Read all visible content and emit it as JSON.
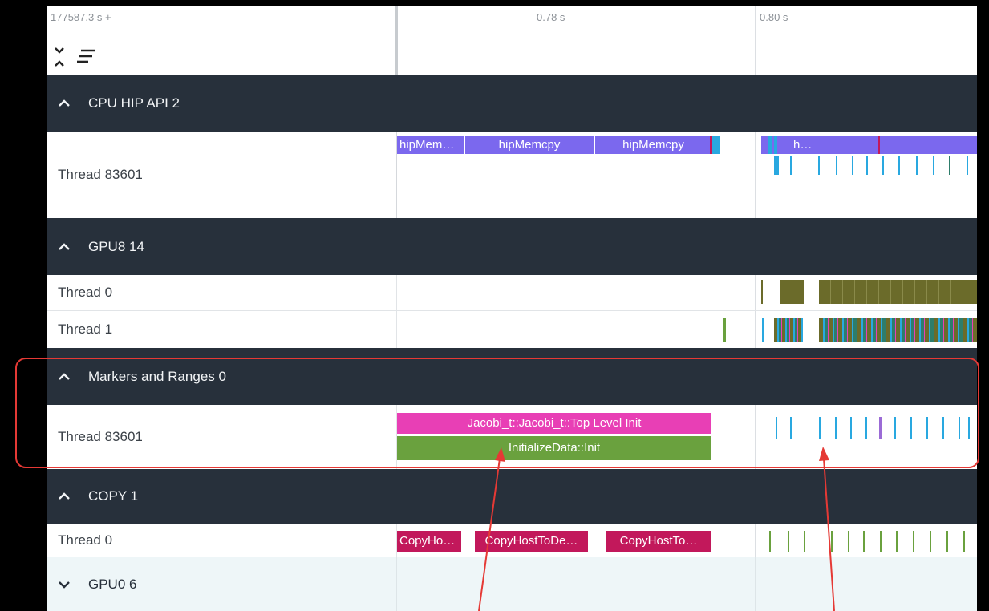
{
  "header": {
    "time_offset": "177587.3 s +",
    "ticks": [
      "0.78 s",
      "0.80 s"
    ],
    "expand_icon": "expand-all-icon",
    "collapse_icon": "collapse-all-icon"
  },
  "groups": [
    {
      "title": "CPU HIP API 2",
      "state": "expanded",
      "threads": [
        {
          "label": "Thread 83601",
          "slices": [
            "hipMem…",
            "hipMemcpy",
            "hipMemcpy",
            "h…"
          ]
        }
      ]
    },
    {
      "title": "GPU8 14",
      "state": "expanded",
      "threads": [
        {
          "label": "Thread 0"
        },
        {
          "label": "Thread 1"
        }
      ]
    },
    {
      "title": "Markers and Ranges 0",
      "state": "expanded",
      "threads": [
        {
          "label": "Thread 83601",
          "slices": [
            "Jacobi_t::Jacobi_t::Top Level Init",
            "InitializeData::Init"
          ]
        }
      ]
    },
    {
      "title": "COPY 1",
      "state": "expanded",
      "threads": [
        {
          "label": "Thread 0",
          "slices": [
            "CopyHo…",
            "CopyHostToDe…",
            "CopyHostTo…"
          ]
        }
      ]
    },
    {
      "title": "GPU0 6",
      "state": "collapsed",
      "threads": []
    }
  ],
  "colors": {
    "group_bg": "#27303b",
    "hip_api": "#7b68ee",
    "hip_light": "#29a8e0",
    "gpu_kernel": "#6b6b2a",
    "marker_pink": "#e83fb5",
    "marker_green": "#6aa13e",
    "copy": "#c2185b",
    "annotation": "#e53935"
  }
}
